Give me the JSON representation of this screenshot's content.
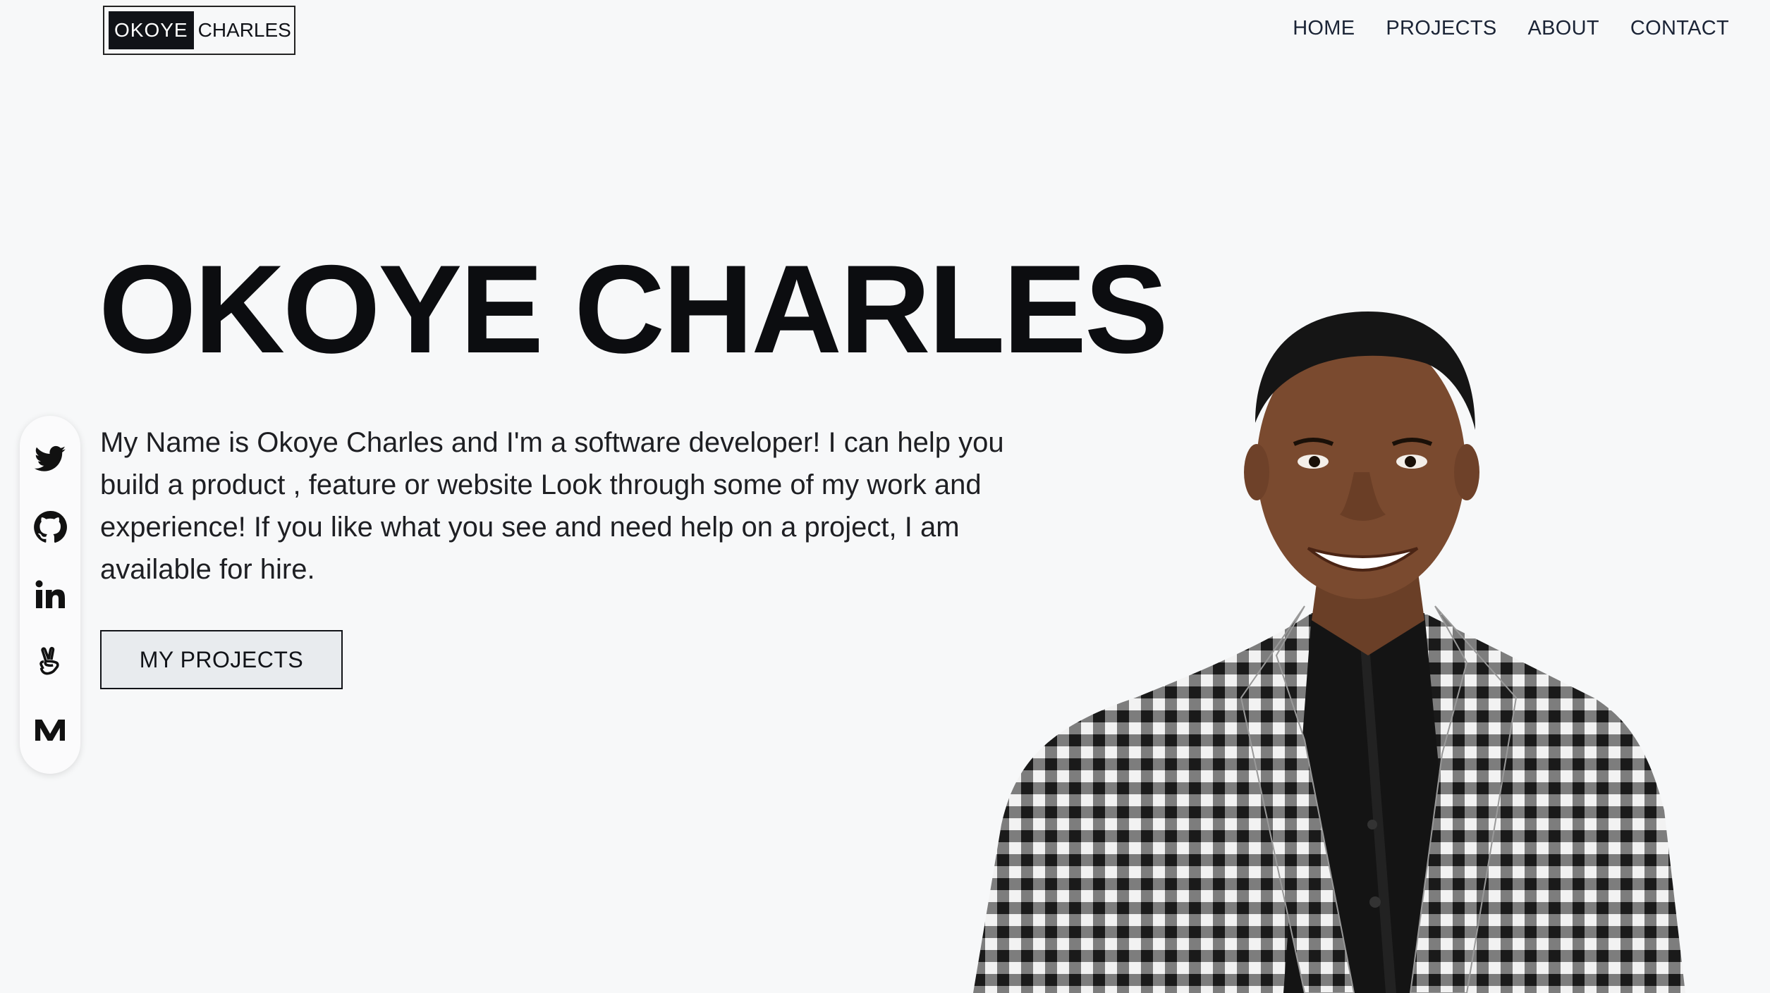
{
  "header": {
    "logo_part1": "OKOYE",
    "logo_part2": "CHARLES",
    "nav": [
      "HOME",
      "PROJECTS",
      "ABOUT",
      "CONTACT"
    ]
  },
  "hero": {
    "title": "OKOYE CHARLES",
    "description": "My Name is Okoye Charles and I'm a software developer! I can help you build a product , feature or website Look through some of my work and experience! If you like what you see and need help on a project, I am available for hire.",
    "cta_label": "MY PROJECTS"
  },
  "social": {
    "icons": [
      "twitter-icon",
      "github-icon",
      "linkedin-icon",
      "angellist-icon",
      "medium-icon"
    ]
  },
  "colors": {
    "background": "#f7f8f9",
    "text": "#111318",
    "nav": "#1b2436",
    "button_bg": "#e8ebee"
  }
}
